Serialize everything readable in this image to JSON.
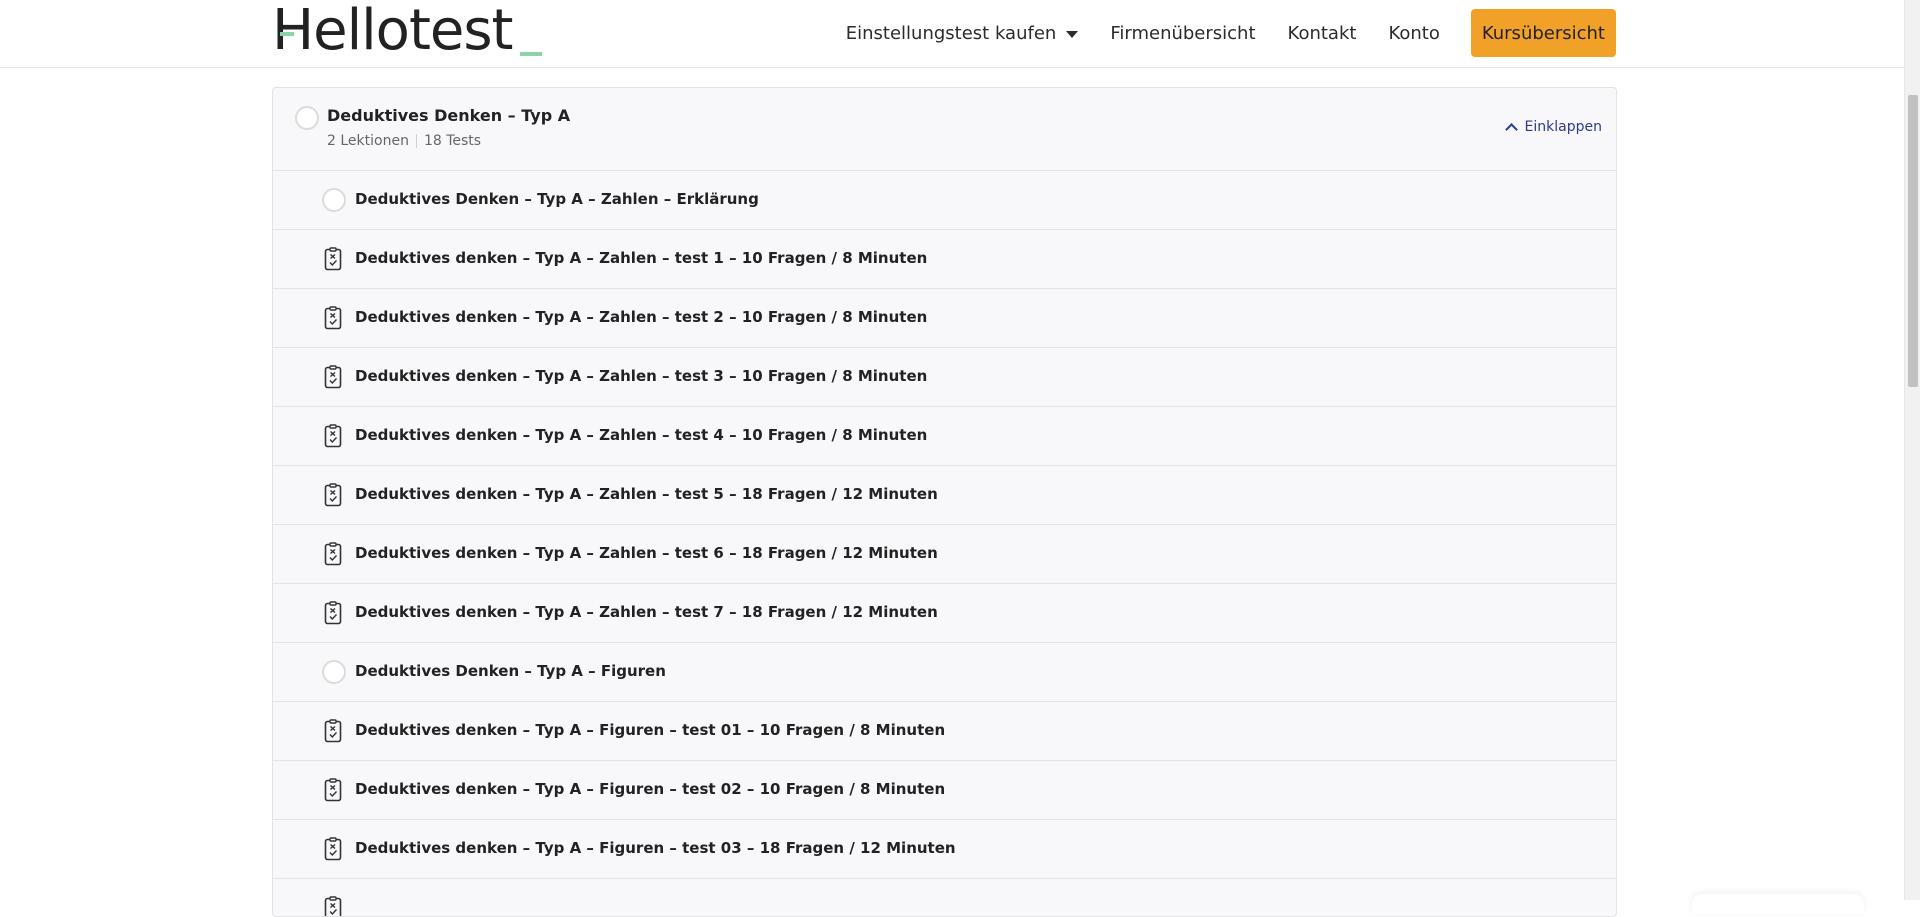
{
  "header": {
    "logo": "Hellotest",
    "nav": [
      {
        "label": "Einstellungstest kaufen",
        "has_dropdown": true
      },
      {
        "label": "Firmenübersicht"
      },
      {
        "label": "Kontakt"
      },
      {
        "label": "Konto"
      }
    ],
    "cta_label": "Kursübersicht",
    "cta_color": "#f2a128"
  },
  "section": {
    "title": "Deduktives Denken – Typ A",
    "lessons_count": "2 Lektionen",
    "tests_count": "18 Tests",
    "collapse_label": "Einklappen",
    "rows": [
      {
        "type": "lesson",
        "icon": "circle-status-icon",
        "title": "Deduktives Denken – Typ A – Zahlen – Erklärung"
      },
      {
        "type": "quiz",
        "icon": "quiz-icon",
        "title": "Deduktives denken – Typ A – Zahlen – test 1 – 10 Fragen / 8 Minuten"
      },
      {
        "type": "quiz",
        "icon": "quiz-icon",
        "title": "Deduktives denken – Typ A – Zahlen – test 2 – 10 Fragen / 8 Minuten"
      },
      {
        "type": "quiz",
        "icon": "quiz-icon",
        "title": "Deduktives denken – Typ A – Zahlen – test 3 – 10 Fragen / 8 Minuten"
      },
      {
        "type": "quiz",
        "icon": "quiz-icon",
        "title": "Deduktives denken – Typ A – Zahlen – test 4 – 10 Fragen / 8 Minuten"
      },
      {
        "type": "quiz",
        "icon": "quiz-icon",
        "title": "Deduktives denken – Typ A – Zahlen – test 5 – 18 Fragen / 12 Minuten"
      },
      {
        "type": "quiz",
        "icon": "quiz-icon",
        "title": "Deduktives denken – Typ A – Zahlen – test 6 – 18 Fragen / 12 Minuten"
      },
      {
        "type": "quiz",
        "icon": "quiz-icon",
        "title": "Deduktives denken – Typ A – Zahlen – test 7 – 18 Fragen / 12 Minuten"
      },
      {
        "type": "lesson",
        "icon": "circle-status-icon",
        "title": "Deduktives Denken – Typ A – Figuren"
      },
      {
        "type": "quiz",
        "icon": "quiz-icon",
        "title": "Deduktives denken – Typ A – Figuren – test 01 – 10 Fragen / 8 Minuten"
      },
      {
        "type": "quiz",
        "icon": "quiz-icon",
        "title": "Deduktives denken – Typ A – Figuren – test 02 – 10 Fragen / 8 Minuten"
      },
      {
        "type": "quiz",
        "icon": "quiz-icon",
        "title": "Deduktives denken – Typ A – Figuren – test 03 – 18 Fragen / 12 Minuten"
      },
      {
        "type": "quiz",
        "icon": "quiz-icon",
        "title": ""
      }
    ]
  }
}
